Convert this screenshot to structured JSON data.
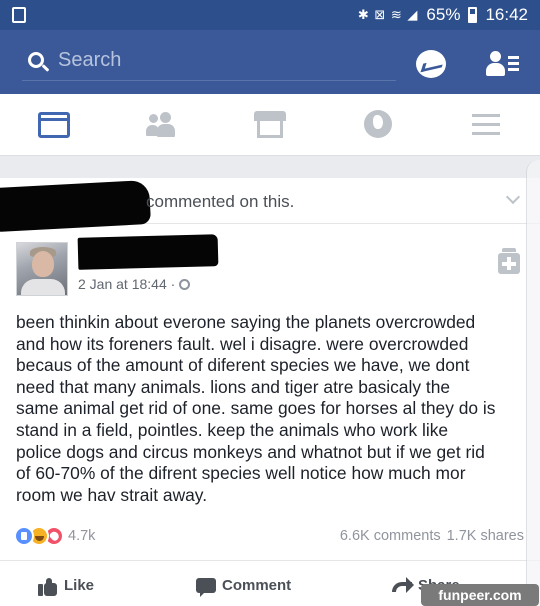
{
  "status_bar": {
    "battery": "65%",
    "time": "16:42",
    "icons": [
      "bluetooth-icon",
      "mute-icon",
      "wifi-icon",
      "signal-icon",
      "battery-icon"
    ]
  },
  "search": {
    "placeholder": "Search"
  },
  "tabs": [
    "news-feed-icon",
    "friends-icon",
    "marketplace-icon",
    "notifications-globe-icon",
    "menu-icon"
  ],
  "activity": {
    "text": "commented on this."
  },
  "post": {
    "timestamp": "2 Jan at 18:44 ·",
    "lines": [
      "been thinkin about everone saying the planets overcrowded",
      "and how its foreners fault. wel i disagre. were overcrowded",
      "becaus of the amount of diferent species we have, we dont",
      "need that many animals. lions and tiger atre basicaly the",
      "same animal get rid of one. same goes for horses al they do is",
      "stand in a field, pointles. keep the animals who work like",
      "police dogs and circus monkeys and whatnot but if we get rid",
      "of 60-70% of the difrent species well notice how much mor",
      "room we hav strait away."
    ],
    "reactions_count": "4.7k",
    "comments": "6.6K comments",
    "shares": "1.7K shares"
  },
  "actions": {
    "like": "Like",
    "comment": "Comment",
    "share": "Share"
  },
  "watermark": "funpeer.com",
  "colors": {
    "header": "#3b5998",
    "status_bar": "#2d4f8c",
    "active_tab": "#4267b2"
  }
}
